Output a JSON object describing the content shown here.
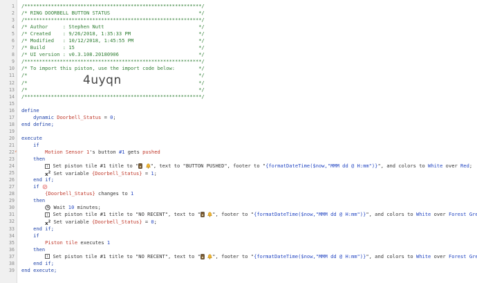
{
  "lines": [
    {
      "n": "1",
      "parts": [
        {
          "t": "/************************************************************/",
          "c": "c"
        }
      ]
    },
    {
      "n": "2",
      "parts": [
        {
          "t": "/* RING DOORBELL BUTTON STATUS                              */",
          "c": "c"
        }
      ]
    },
    {
      "n": "3",
      "parts": [
        {
          "t": "/************************************************************/",
          "c": "c"
        }
      ]
    },
    {
      "n": "4",
      "parts": [
        {
          "t": "/* Author     : Stephen Nutt                                */",
          "c": "c"
        }
      ]
    },
    {
      "n": "5",
      "parts": [
        {
          "t": "/* Created    : 9/26/2018, 1:35:33 PM                       */",
          "c": "c"
        }
      ]
    },
    {
      "n": "6",
      "parts": [
        {
          "t": "/* Modified   : 10/12/2018, 1:45:55 PM                      */",
          "c": "c"
        }
      ]
    },
    {
      "n": "7",
      "parts": [
        {
          "t": "/* Build      : 15                                          */",
          "c": "c"
        }
      ]
    },
    {
      "n": "8",
      "parts": [
        {
          "t": "/* UI version : v0.3.108.20180906                           */",
          "c": "c"
        }
      ]
    },
    {
      "n": "9",
      "parts": [
        {
          "t": "/************************************************************/",
          "c": "c"
        }
      ]
    },
    {
      "n": "10",
      "parts": [
        {
          "t": "/* To import this piston, use the import code below:        */",
          "c": "c"
        }
      ]
    },
    {
      "n": "11",
      "parts": [
        {
          "t": "/*                                                          */",
          "c": "c"
        }
      ]
    },
    {
      "n": "12",
      "parts": [
        {
          "t": "/*                                                          */",
          "c": "c"
        }
      ],
      "big": "4uyqn"
    },
    {
      "n": "13",
      "parts": [
        {
          "t": "/*                                                          */",
          "c": "c"
        }
      ]
    },
    {
      "n": "14",
      "parts": [
        {
          "t": "/************************************************************/",
          "c": "c"
        }
      ]
    },
    {
      "n": "15",
      "parts": []
    },
    {
      "n": "16",
      "parts": [
        {
          "t": "define",
          "c": "kw"
        }
      ]
    },
    {
      "n": "17",
      "parts": [
        {
          "t": "    dynamic ",
          "c": "kw"
        },
        {
          "t": "Doorbell_Status",
          "c": "var"
        },
        {
          "t": " = ",
          "c": "op"
        },
        {
          "t": "0",
          "c": "num-lit"
        },
        {
          "t": ";",
          "c": "op"
        }
      ]
    },
    {
      "n": "18",
      "parts": [
        {
          "t": "end define;",
          "c": "kw"
        }
      ]
    },
    {
      "n": "19",
      "parts": []
    },
    {
      "n": "20",
      "parts": [
        {
          "t": "execute",
          "c": "kw"
        }
      ]
    },
    {
      "n": "21",
      "parts": [
        {
          "t": "    if",
          "c": "kw"
        }
      ]
    },
    {
      "n": "22",
      "mark": "⚡",
      "parts": [
        {
          "t": "        Motion Sensor 1",
          "c": "dev"
        },
        {
          "t": "'s button ",
          "c": "txt"
        },
        {
          "t": "#1",
          "c": "num-lit"
        },
        {
          "t": " gets ",
          "c": "txt"
        },
        {
          "t": "pushed",
          "c": "var"
        }
      ]
    },
    {
      "n": "23",
      "parts": [
        {
          "t": "    then",
          "c": "kw"
        }
      ]
    },
    {
      "n": "24",
      "parts": [
        {
          "t": "        ",
          "c": "txt"
        },
        {
          "icon": "info"
        },
        {
          "t": " Set piston tile #1 title to \"",
          "c": "txt"
        },
        {
          "icon": "doorbell"
        },
        {
          "t": " ",
          "c": "txt"
        },
        {
          "icon": "bell"
        },
        {
          "t": "\", text to \"BUTTON PUSHED\", footer to \"",
          "c": "txt"
        },
        {
          "t": "{formatDateTime($now,\"MMM dd @ H:mm\")}",
          "c": "str"
        },
        {
          "t": "\", and colors to ",
          "c": "txt"
        },
        {
          "t": "White",
          "c": "str"
        },
        {
          "t": " over ",
          "c": "txt"
        },
        {
          "t": "Red",
          "c": "str"
        },
        {
          "t": ";",
          "c": "txt"
        }
      ]
    },
    {
      "n": "25",
      "parts": [
        {
          "t": "        ",
          "c": "txt"
        },
        {
          "icon": "x2"
        },
        {
          "t": " Set variable ",
          "c": "txt"
        },
        {
          "t": "{Doorbell_Status}",
          "c": "var"
        },
        {
          "t": " = ",
          "c": "txt"
        },
        {
          "t": "1",
          "c": "num-lit"
        },
        {
          "t": ";",
          "c": "txt"
        }
      ]
    },
    {
      "n": "26",
      "parts": [
        {
          "t": "    end if;",
          "c": "kw"
        }
      ]
    },
    {
      "n": "27",
      "parts": [
        {
          "t": "    if ",
          "c": "kw"
        },
        {
          "icon": "ban"
        }
      ]
    },
    {
      "n": "28",
      "parts": [
        {
          "t": "        ",
          "c": "txt"
        },
        {
          "t": "{Doorbell_Status}",
          "c": "var"
        },
        {
          "t": " changes to ",
          "c": "txt"
        },
        {
          "t": "1",
          "c": "num-lit"
        }
      ]
    },
    {
      "n": "29",
      "parts": [
        {
          "t": "    then",
          "c": "kw"
        }
      ]
    },
    {
      "n": "30",
      "parts": [
        {
          "t": "        ",
          "c": "txt"
        },
        {
          "icon": "clock"
        },
        {
          "t": " Wait ",
          "c": "txt"
        },
        {
          "t": "10",
          "c": "num-lit"
        },
        {
          "t": " minutes;",
          "c": "txt"
        }
      ]
    },
    {
      "n": "31",
      "parts": [
        {
          "t": "        ",
          "c": "txt"
        },
        {
          "icon": "info"
        },
        {
          "t": " Set piston tile #1 title to \"NO RECENT\", text to \"",
          "c": "txt"
        },
        {
          "icon": "doorbell"
        },
        {
          "t": " ",
          "c": "txt"
        },
        {
          "icon": "bell"
        },
        {
          "t": "\", footer to \"",
          "c": "txt"
        },
        {
          "t": "{formatDateTime($now,\"MMM dd @ H:mm\")}",
          "c": "str"
        },
        {
          "t": "\", and colors to ",
          "c": "txt"
        },
        {
          "t": "White",
          "c": "str"
        },
        {
          "t": " over ",
          "c": "txt"
        },
        {
          "t": "Forest Green",
          "c": "str"
        },
        {
          "t": ";",
          "c": "txt"
        }
      ]
    },
    {
      "n": "32",
      "parts": [
        {
          "t": "        ",
          "c": "txt"
        },
        {
          "icon": "x2"
        },
        {
          "t": " Set variable ",
          "c": "txt"
        },
        {
          "t": "{Doorbell_Status}",
          "c": "var"
        },
        {
          "t": " = ",
          "c": "txt"
        },
        {
          "t": "0",
          "c": "num-lit"
        },
        {
          "t": ";",
          "c": "txt"
        }
      ]
    },
    {
      "n": "33",
      "parts": [
        {
          "t": "    end if;",
          "c": "kw"
        }
      ]
    },
    {
      "n": "34",
      "parts": [
        {
          "t": "    if",
          "c": "kw"
        }
      ]
    },
    {
      "n": "35",
      "parts": [
        {
          "t": "        Piston tile",
          "c": "dev"
        },
        {
          "t": " executes ",
          "c": "txt"
        },
        {
          "t": "1",
          "c": "num-lit"
        }
      ]
    },
    {
      "n": "36",
      "parts": [
        {
          "t": "    then",
          "c": "kw"
        }
      ]
    },
    {
      "n": "37",
      "parts": [
        {
          "t": "        ",
          "c": "txt"
        },
        {
          "icon": "info"
        },
        {
          "t": " Set piston tile #1 title to \"NO RECENT\", text to \"",
          "c": "txt"
        },
        {
          "icon": "doorbell"
        },
        {
          "t": " ",
          "c": "txt"
        },
        {
          "icon": "bell"
        },
        {
          "t": "\", footer to \"",
          "c": "txt"
        },
        {
          "t": "{formatDateTime($now,\"MMM dd @ H:mm\")}",
          "c": "str"
        },
        {
          "t": "\", and colors to ",
          "c": "txt"
        },
        {
          "t": "White",
          "c": "str"
        },
        {
          "t": " over ",
          "c": "txt"
        },
        {
          "t": "Forest Green",
          "c": "str"
        },
        {
          "t": ";",
          "c": "txt"
        }
      ]
    },
    {
      "n": "38",
      "parts": [
        {
          "t": "    end if;",
          "c": "kw"
        }
      ]
    },
    {
      "n": "39",
      "parts": [
        {
          "t": "end execute;",
          "c": "kw"
        }
      ]
    }
  ],
  "icons": {
    "info": "info-icon",
    "x2": "set-variable-icon",
    "clock": "clock-icon",
    "ban": "disabled-icon",
    "doorbell": "doorbell-icon",
    "bell": "bell-icon"
  },
  "colors": {
    "comment": "#2e7d32",
    "keyword": "#1a3fa8",
    "variable": "#c0392b",
    "string": "#2346c2"
  }
}
